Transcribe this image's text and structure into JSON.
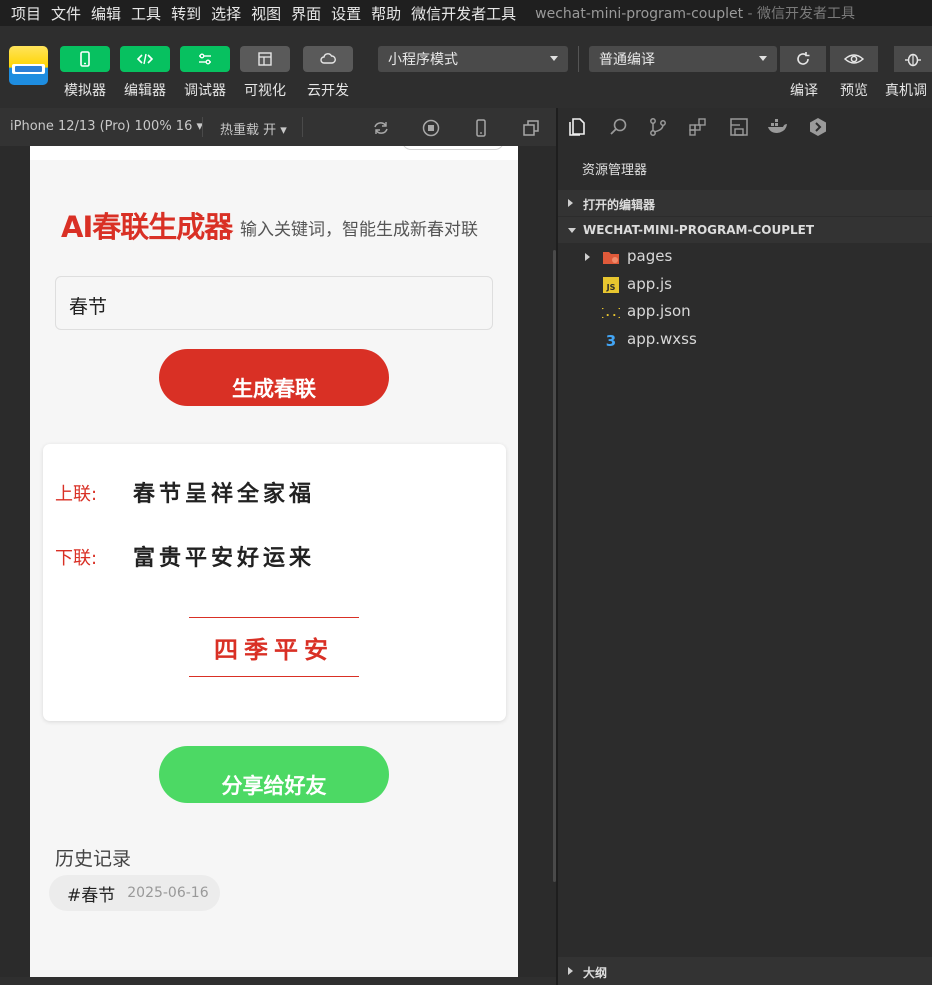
{
  "menu": {
    "items": [
      "项目",
      "文件",
      "编辑",
      "工具",
      "转到",
      "选择",
      "视图",
      "界面",
      "设置",
      "帮助",
      "微信开发者工具"
    ],
    "window_title": "wechat-mini-program-couplet",
    "window_suffix": " - 微信开发者工具"
  },
  "toolbar": {
    "buttons": [
      {
        "label": "模拟器",
        "icon": "phone-icon"
      },
      {
        "label": "编辑器",
        "icon": "code-icon"
      },
      {
        "label": "调试器",
        "icon": "sliders-icon"
      },
      {
        "label": "可视化",
        "icon": "layout-icon"
      },
      {
        "label": "云开发",
        "icon": "cloud-icon"
      }
    ],
    "mode_select": "小程序模式",
    "compile_select": "普通编译",
    "right_labels": {
      "compile": "编译",
      "preview": "预览",
      "device": "真机调"
    }
  },
  "simbar": {
    "device": "iPhone 12/13 (Pro) 100% 16 ▾",
    "hot_reload": "热重载 开 ▾"
  },
  "app": {
    "title": "AI春联生成器",
    "subtitle": "输入关键词，智能生成新春对联",
    "keyword_value": "春节",
    "generate_label": "生成春联",
    "upper_label": "上联:",
    "upper_text": "春节呈祥全家福",
    "lower_label": "下联:",
    "lower_text": "富贵平安好运来",
    "horizontal_text": "四季平安",
    "share_label": "分享给好友",
    "history_title": "历史记录",
    "history": [
      {
        "keyword": "#春节",
        "date": "2025-06-16"
      }
    ]
  },
  "explorer": {
    "title": "资源管理器",
    "open_editors": "打开的编辑器",
    "project": "WECHAT-MINI-PROGRAM-COUPLET",
    "files": [
      {
        "name": "pages",
        "icon": "folder-icon"
      },
      {
        "name": "app.js",
        "icon": "js-icon"
      },
      {
        "name": "app.json",
        "icon": "json-icon"
      },
      {
        "name": "app.wxss",
        "icon": "css-icon"
      }
    ],
    "outline": "大纲"
  },
  "colors": {
    "accent_red": "#d93025",
    "accent_green": "#07c160",
    "share_green": "#4cd964"
  }
}
